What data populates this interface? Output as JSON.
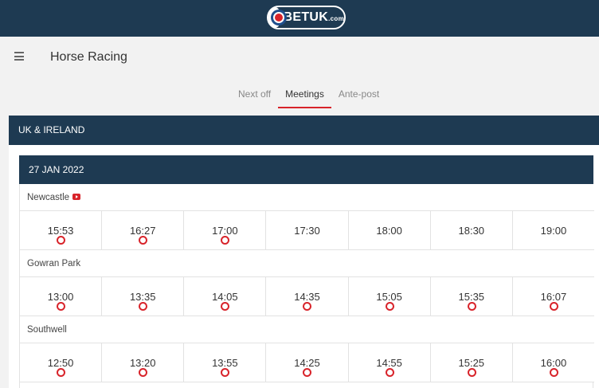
{
  "brand": {
    "name": "BETUK",
    "suffix": ".com"
  },
  "page": {
    "title": "Horse Racing"
  },
  "tabs": [
    {
      "label": "Next off",
      "active": false
    },
    {
      "label": "Meetings",
      "active": true
    },
    {
      "label": "Ante-post",
      "active": false
    }
  ],
  "region": {
    "label": "UK & IRELAND"
  },
  "date": {
    "label": "27 JAN 2022"
  },
  "meetings": [
    {
      "name": "Newcastle",
      "has_stream": true,
      "races": [
        {
          "time": "15:53",
          "indicator": true
        },
        {
          "time": "16:27",
          "indicator": true
        },
        {
          "time": "17:00",
          "indicator": true
        },
        {
          "time": "17:30",
          "indicator": false
        },
        {
          "time": "18:00",
          "indicator": false
        },
        {
          "time": "18:30",
          "indicator": false
        },
        {
          "time": "19:00",
          "indicator": false
        }
      ]
    },
    {
      "name": "Gowran Park",
      "has_stream": false,
      "races": [
        {
          "time": "13:00",
          "indicator": true
        },
        {
          "time": "13:35",
          "indicator": true
        },
        {
          "time": "14:05",
          "indicator": true
        },
        {
          "time": "14:35",
          "indicator": true
        },
        {
          "time": "15:05",
          "indicator": true
        },
        {
          "time": "15:35",
          "indicator": true
        },
        {
          "time": "16:07",
          "indicator": true
        }
      ]
    },
    {
      "name": "Southwell",
      "has_stream": false,
      "races": [
        {
          "time": "12:50",
          "indicator": true
        },
        {
          "time": "13:20",
          "indicator": true
        },
        {
          "time": "13:55",
          "indicator": true
        },
        {
          "time": "14:25",
          "indicator": true
        },
        {
          "time": "14:55",
          "indicator": true
        },
        {
          "time": "15:25",
          "indicator": true
        },
        {
          "time": "16:00",
          "indicator": true
        }
      ]
    }
  ],
  "colors": {
    "header": "#1e3a52",
    "accent": "#d8232a"
  }
}
